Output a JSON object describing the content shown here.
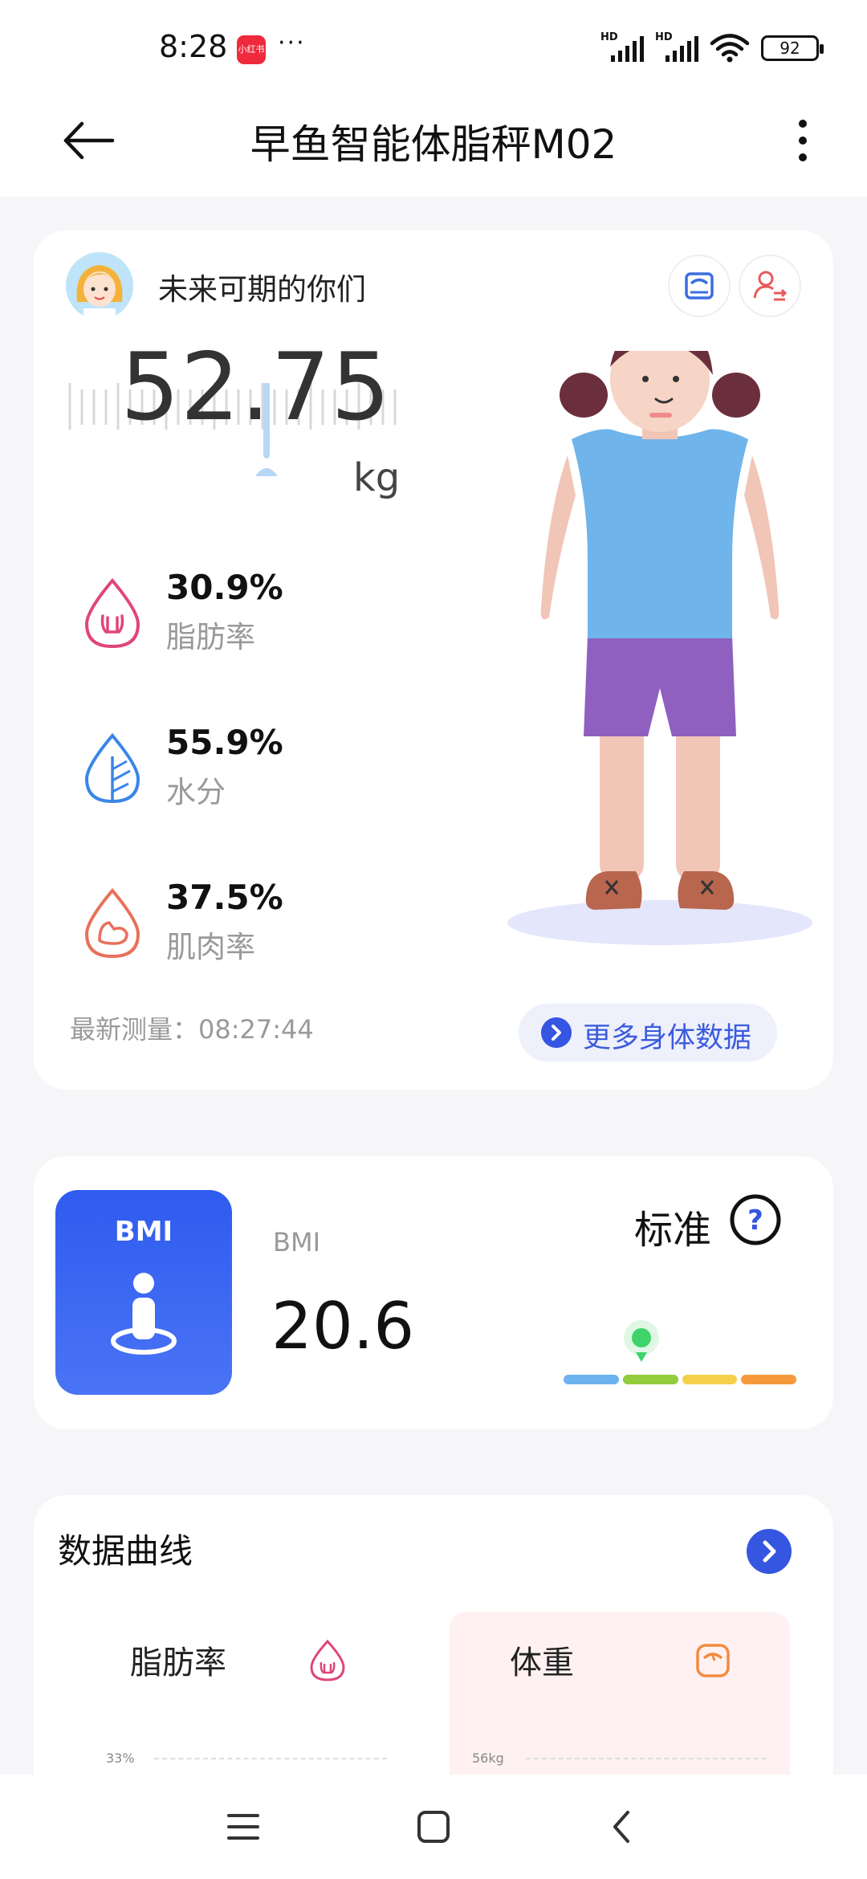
{
  "status_bar": {
    "time": "8:28",
    "app_badge": "小红书",
    "more": "···",
    "battery": "92",
    "signal_label": "HD"
  },
  "header": {
    "title": "早鱼智能体脂秤M02"
  },
  "profile": {
    "name": "未来可期的你们"
  },
  "weight": {
    "value": "52.75",
    "unit": "kg"
  },
  "metrics": [
    {
      "value": "30.9%",
      "label": "脂肪率",
      "color": "#e0457b"
    },
    {
      "value": "55.9%",
      "label": "水分",
      "color": "#3a86e8"
    },
    {
      "value": "37.5%",
      "label": "肌肉率",
      "color": "#e8705a"
    }
  ],
  "latest_measure": "最新测量：08:27:44",
  "more_data_label": "更多身体数据",
  "bmi": {
    "tile_label": "BMI",
    "label": "BMI",
    "value": "20.6",
    "status": "标准",
    "scale_level": 0.35,
    "scale_colors": [
      "#6cb3f0",
      "#93cc3c",
      "#f5d04a",
      "#f59a3c"
    ]
  },
  "curves": {
    "title": "数据曲线",
    "tabs": [
      {
        "name": "脂肪率",
        "axis_label": "33%"
      },
      {
        "name": "体重",
        "axis_label": "56kg"
      }
    ]
  },
  "colors": {
    "accent": "#3556e0",
    "background": "#f6f6f8"
  }
}
